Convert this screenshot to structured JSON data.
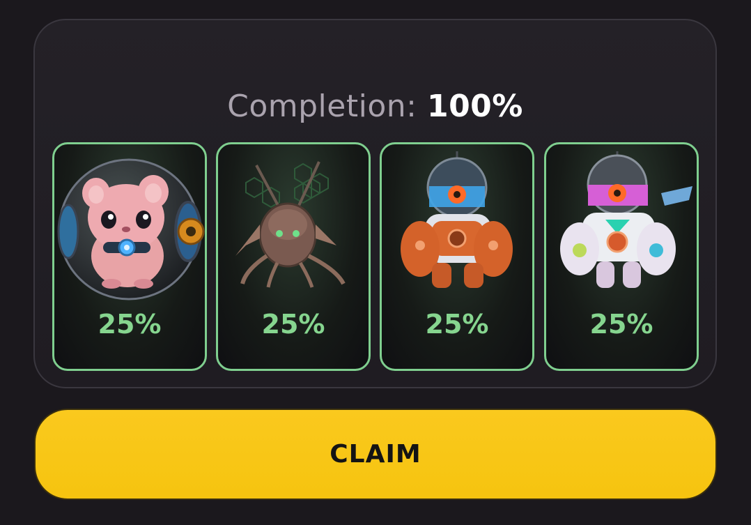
{
  "completion": {
    "label": "Completion:",
    "value": "100%"
  },
  "cards": [
    {
      "name": "hamster-in-ball",
      "percent": "25%"
    },
    {
      "name": "insect-drone",
      "percent": "25%"
    },
    {
      "name": "orange-robot",
      "percent": "25%"
    },
    {
      "name": "pink-mech-robot",
      "percent": "25%"
    }
  ],
  "claim": {
    "label": "CLAIM"
  },
  "colors": {
    "accent_green": "#86d58f",
    "button_yellow": "#f8c716",
    "background": "#1b181d"
  }
}
